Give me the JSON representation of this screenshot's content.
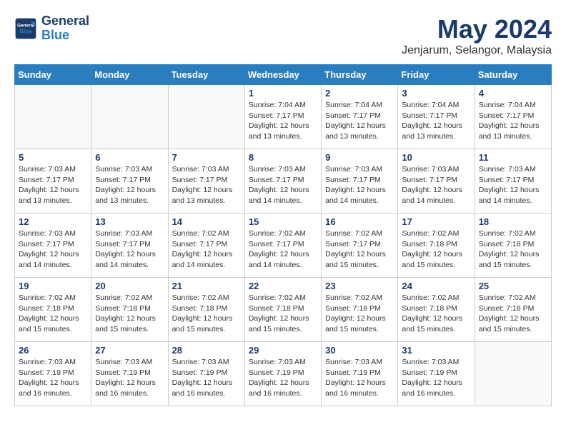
{
  "header": {
    "logo_line1": "General",
    "logo_line2": "Blue",
    "month_title": "May 2024",
    "subtitle": "Jenjarum, Selangor, Malaysia"
  },
  "days_of_week": [
    "Sunday",
    "Monday",
    "Tuesday",
    "Wednesday",
    "Thursday",
    "Friday",
    "Saturday"
  ],
  "weeks": [
    [
      {
        "num": "",
        "info": ""
      },
      {
        "num": "",
        "info": ""
      },
      {
        "num": "",
        "info": ""
      },
      {
        "num": "1",
        "info": "Sunrise: 7:04 AM\nSunset: 7:17 PM\nDaylight: 12 hours\nand 13 minutes."
      },
      {
        "num": "2",
        "info": "Sunrise: 7:04 AM\nSunset: 7:17 PM\nDaylight: 12 hours\nand 13 minutes."
      },
      {
        "num": "3",
        "info": "Sunrise: 7:04 AM\nSunset: 7:17 PM\nDaylight: 12 hours\nand 13 minutes."
      },
      {
        "num": "4",
        "info": "Sunrise: 7:04 AM\nSunset: 7:17 PM\nDaylight: 12 hours\nand 13 minutes."
      }
    ],
    [
      {
        "num": "5",
        "info": "Sunrise: 7:03 AM\nSunset: 7:17 PM\nDaylight: 12 hours\nand 13 minutes."
      },
      {
        "num": "6",
        "info": "Sunrise: 7:03 AM\nSunset: 7:17 PM\nDaylight: 12 hours\nand 13 minutes."
      },
      {
        "num": "7",
        "info": "Sunrise: 7:03 AM\nSunset: 7:17 PM\nDaylight: 12 hours\nand 13 minutes."
      },
      {
        "num": "8",
        "info": "Sunrise: 7:03 AM\nSunset: 7:17 PM\nDaylight: 12 hours\nand 14 minutes."
      },
      {
        "num": "9",
        "info": "Sunrise: 7:03 AM\nSunset: 7:17 PM\nDaylight: 12 hours\nand 14 minutes."
      },
      {
        "num": "10",
        "info": "Sunrise: 7:03 AM\nSunset: 7:17 PM\nDaylight: 12 hours\nand 14 minutes."
      },
      {
        "num": "11",
        "info": "Sunrise: 7:03 AM\nSunset: 7:17 PM\nDaylight: 12 hours\nand 14 minutes."
      }
    ],
    [
      {
        "num": "12",
        "info": "Sunrise: 7:03 AM\nSunset: 7:17 PM\nDaylight: 12 hours\nand 14 minutes."
      },
      {
        "num": "13",
        "info": "Sunrise: 7:03 AM\nSunset: 7:17 PM\nDaylight: 12 hours\nand 14 minutes."
      },
      {
        "num": "14",
        "info": "Sunrise: 7:02 AM\nSunset: 7:17 PM\nDaylight: 12 hours\nand 14 minutes."
      },
      {
        "num": "15",
        "info": "Sunrise: 7:02 AM\nSunset: 7:17 PM\nDaylight: 12 hours\nand 14 minutes."
      },
      {
        "num": "16",
        "info": "Sunrise: 7:02 AM\nSunset: 7:17 PM\nDaylight: 12 hours\nand 15 minutes."
      },
      {
        "num": "17",
        "info": "Sunrise: 7:02 AM\nSunset: 7:18 PM\nDaylight: 12 hours\nand 15 minutes."
      },
      {
        "num": "18",
        "info": "Sunrise: 7:02 AM\nSunset: 7:18 PM\nDaylight: 12 hours\nand 15 minutes."
      }
    ],
    [
      {
        "num": "19",
        "info": "Sunrise: 7:02 AM\nSunset: 7:18 PM\nDaylight: 12 hours\nand 15 minutes."
      },
      {
        "num": "20",
        "info": "Sunrise: 7:02 AM\nSunset: 7:18 PM\nDaylight: 12 hours\nand 15 minutes."
      },
      {
        "num": "21",
        "info": "Sunrise: 7:02 AM\nSunset: 7:18 PM\nDaylight: 12 hours\nand 15 minutes."
      },
      {
        "num": "22",
        "info": "Sunrise: 7:02 AM\nSunset: 7:18 PM\nDaylight: 12 hours\nand 15 minutes."
      },
      {
        "num": "23",
        "info": "Sunrise: 7:02 AM\nSunset: 7:18 PM\nDaylight: 12 hours\nand 15 minutes."
      },
      {
        "num": "24",
        "info": "Sunrise: 7:02 AM\nSunset: 7:18 PM\nDaylight: 12 hours\nand 15 minutes."
      },
      {
        "num": "25",
        "info": "Sunrise: 7:02 AM\nSunset: 7:18 PM\nDaylight: 12 hours\nand 15 minutes."
      }
    ],
    [
      {
        "num": "26",
        "info": "Sunrise: 7:03 AM\nSunset: 7:19 PM\nDaylight: 12 hours\nand 16 minutes."
      },
      {
        "num": "27",
        "info": "Sunrise: 7:03 AM\nSunset: 7:19 PM\nDaylight: 12 hours\nand 16 minutes."
      },
      {
        "num": "28",
        "info": "Sunrise: 7:03 AM\nSunset: 7:19 PM\nDaylight: 12 hours\nand 16 minutes."
      },
      {
        "num": "29",
        "info": "Sunrise: 7:03 AM\nSunset: 7:19 PM\nDaylight: 12 hours\nand 16 minutes."
      },
      {
        "num": "30",
        "info": "Sunrise: 7:03 AM\nSunset: 7:19 PM\nDaylight: 12 hours\nand 16 minutes."
      },
      {
        "num": "31",
        "info": "Sunrise: 7:03 AM\nSunset: 7:19 PM\nDaylight: 12 hours\nand 16 minutes."
      },
      {
        "num": "",
        "info": ""
      }
    ]
  ]
}
